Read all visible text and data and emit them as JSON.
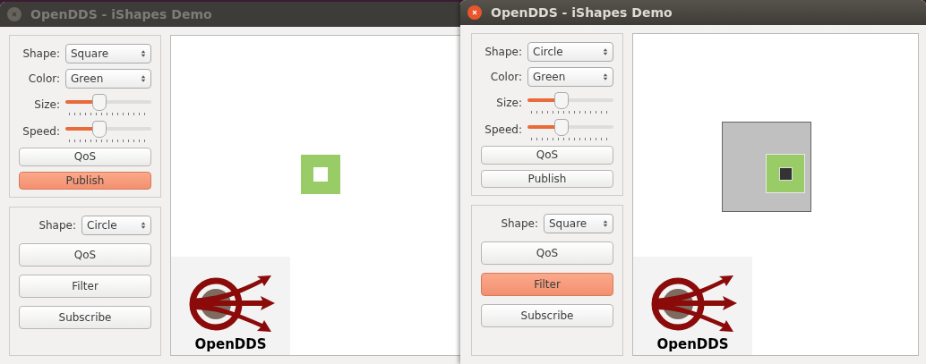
{
  "windows": [
    {
      "title": "OpenDDS - iShapes Demo",
      "active": false,
      "publisher": {
        "shape_label": "Shape:",
        "shape": "Square",
        "color_label": "Color:",
        "color_name": "Green",
        "size_label": "Size:",
        "size": {
          "level": 0.4
        },
        "speed_label": "Speed:",
        "speed": {
          "level": 0.4
        },
        "buttons": [
          {
            "label": "QoS",
            "highlighted": false
          },
          {
            "label": "Publish",
            "highlighted": true
          }
        ]
      },
      "subscriber": {
        "shape_label": "Shape:",
        "shape": "Circle",
        "buttons": [
          {
            "label": "QoS",
            "highlighted": false
          },
          {
            "label": "Filter",
            "highlighted": false
          },
          {
            "label": "Subscribe",
            "highlighted": false
          }
        ]
      },
      "canvas": {
        "shapes": [
          {
            "kind": "square",
            "color": "#99cc66"
          }
        ]
      },
      "logo": {
        "text": "OpenDDS"
      }
    },
    {
      "title": "OpenDDS - iShapes Demo",
      "active": true,
      "publisher": {
        "shape_label": "Shape:",
        "shape": "Circle",
        "color_label": "Color:",
        "color_name": "Green",
        "size_label": "Size:",
        "size": {
          "level": 0.4
        },
        "speed_label": "Speed:",
        "speed": {
          "level": 0.4
        },
        "buttons": [
          {
            "label": "QoS",
            "highlighted": false
          },
          {
            "label": "Publish",
            "highlighted": false
          }
        ]
      },
      "subscriber": {
        "shape_label": "Shape:",
        "shape": "Square",
        "buttons": [
          {
            "label": "QoS",
            "highlighted": false
          },
          {
            "label": "Filter",
            "highlighted": true
          },
          {
            "label": "Subscribe",
            "highlighted": false
          }
        ]
      },
      "canvas": {
        "shapes": [
          {
            "kind": "filter-region",
            "color": "#c0c0c0"
          },
          {
            "kind": "square",
            "color": "#99cc66"
          }
        ]
      },
      "logo": {
        "text": "OpenDDS"
      }
    }
  ]
}
